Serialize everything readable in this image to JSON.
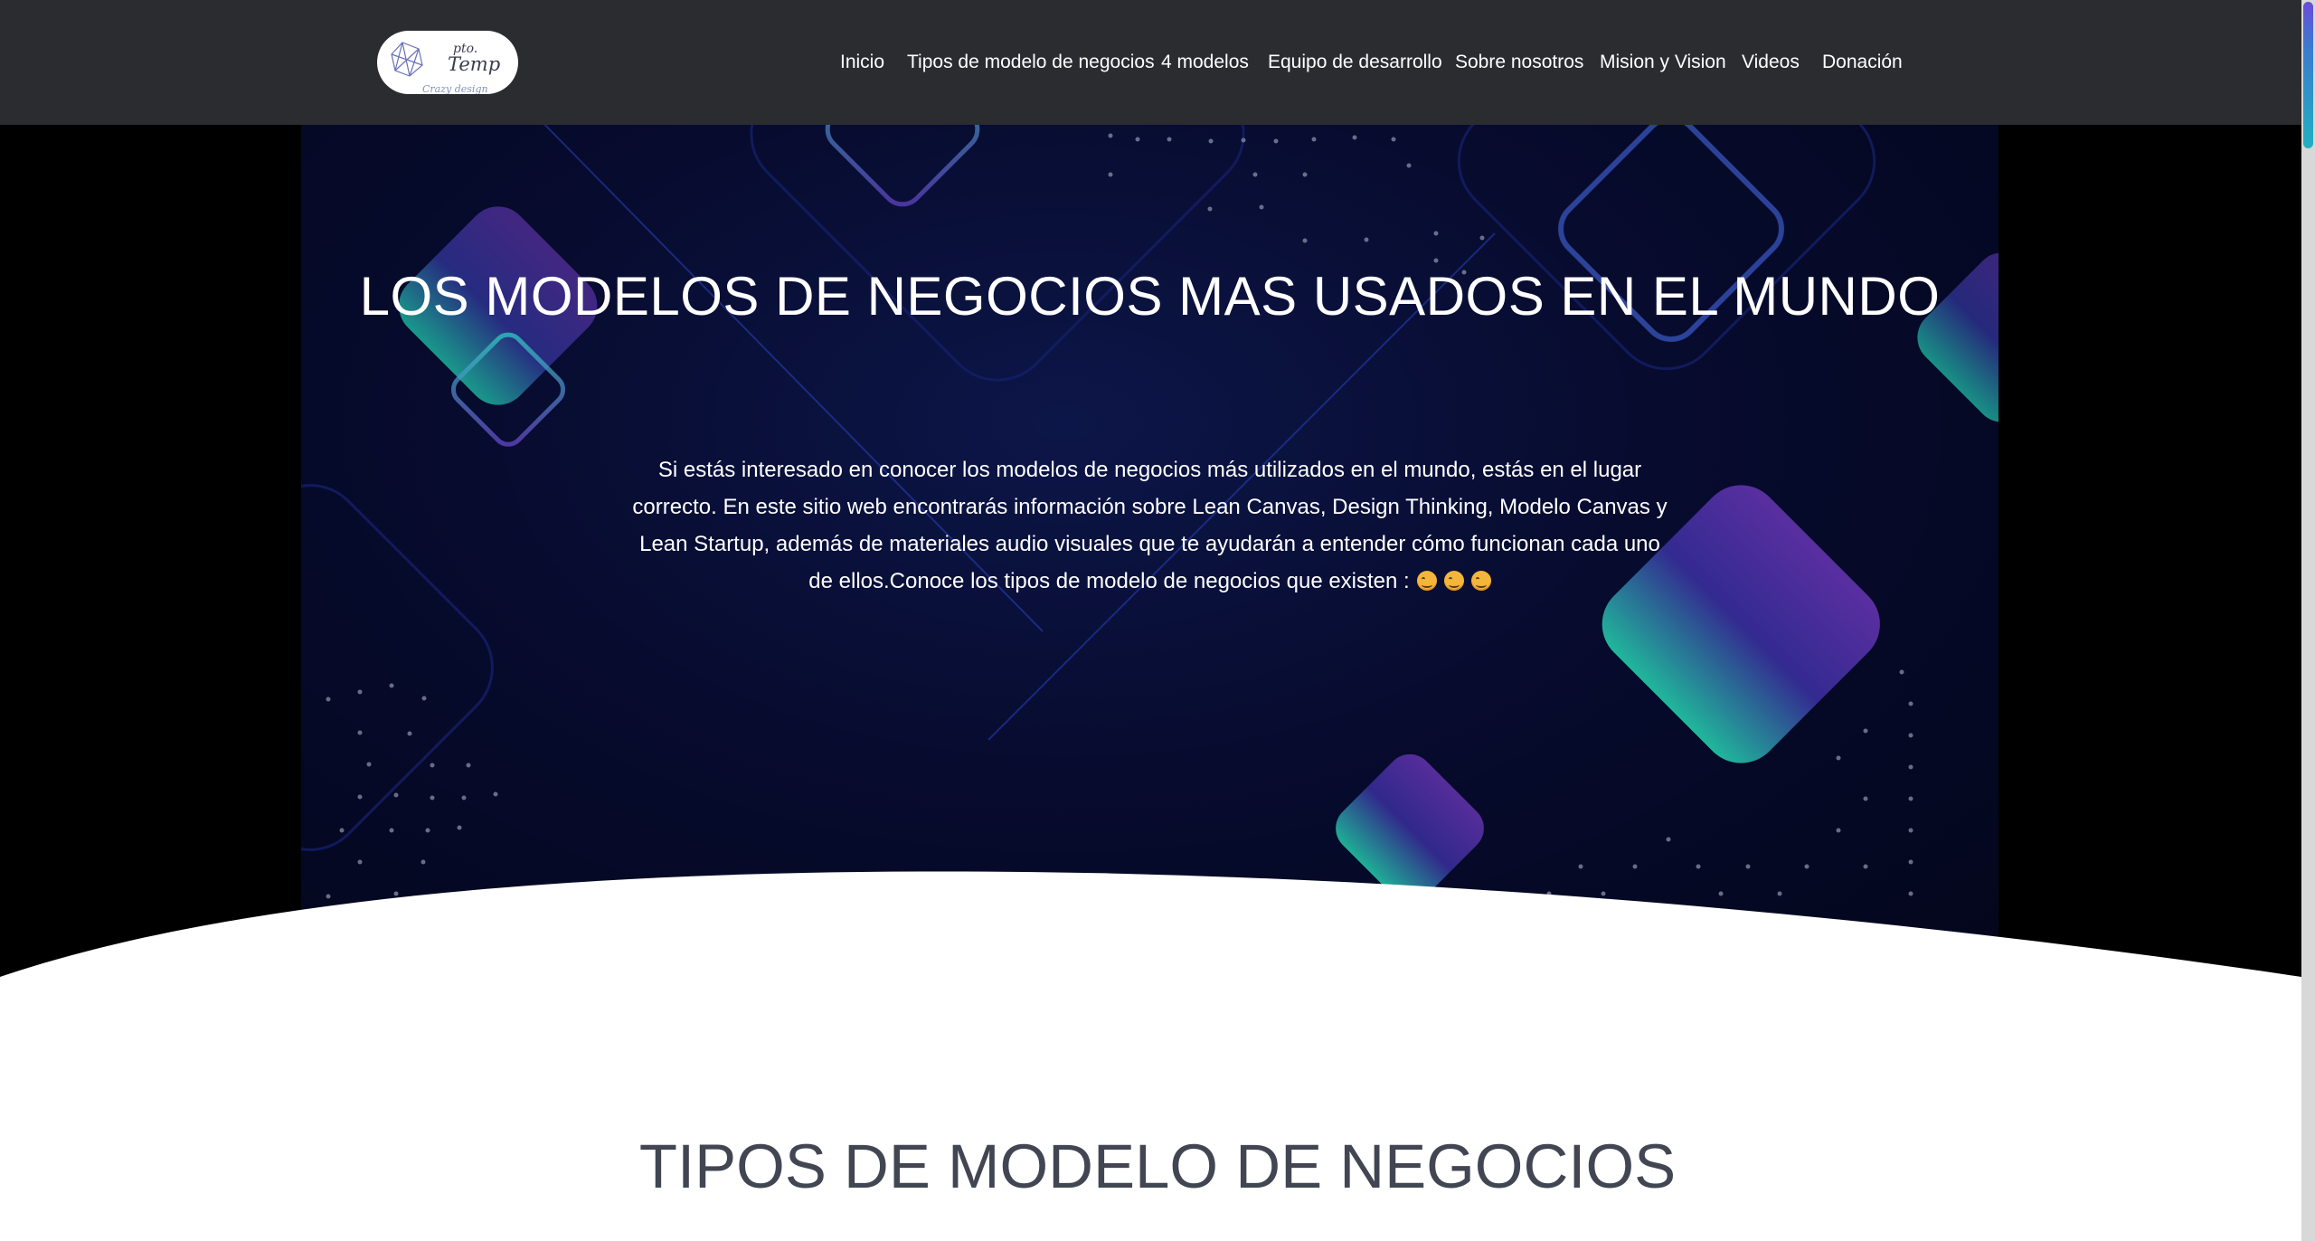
{
  "logo": {
    "text_top": "pto.",
    "text_main": "Temp",
    "tagline": "Crazy design"
  },
  "nav": {
    "items": [
      "Inicio",
      "Tipos de modelo de negocios",
      "4 modelos",
      "Equipo de desarrollo",
      "Sobre nosotros",
      "Mision y Vision",
      "Videos",
      "Donación"
    ]
  },
  "hero": {
    "title": "LOS MODELOS DE NEGOCIOS MAS USADOS EN EL MUNDO",
    "text": "Si estás interesado en conocer los modelos de negocios más utilizados en el mundo, estás en el lugar correcto. En este sitio web encontrarás información sobre Lean Canvas, Design Thinking, Modelo Canvas y Lean Startup, además de materiales audio visuales que te ayudarán a entender cómo funcionan cada uno de ellos.Conoce los tipos de modelo de negocios que existen :",
    "emoji": "smiling-face-icon"
  },
  "section": {
    "title": "TIPOS DE MODELO DE NEGOCIOS"
  },
  "colors": {
    "header_bg": "#2b2c30",
    "hero_bg": "#070b2e",
    "section_title": "#424653",
    "accent_purple": "#5a2fa0",
    "accent_teal": "#1fb59a"
  }
}
